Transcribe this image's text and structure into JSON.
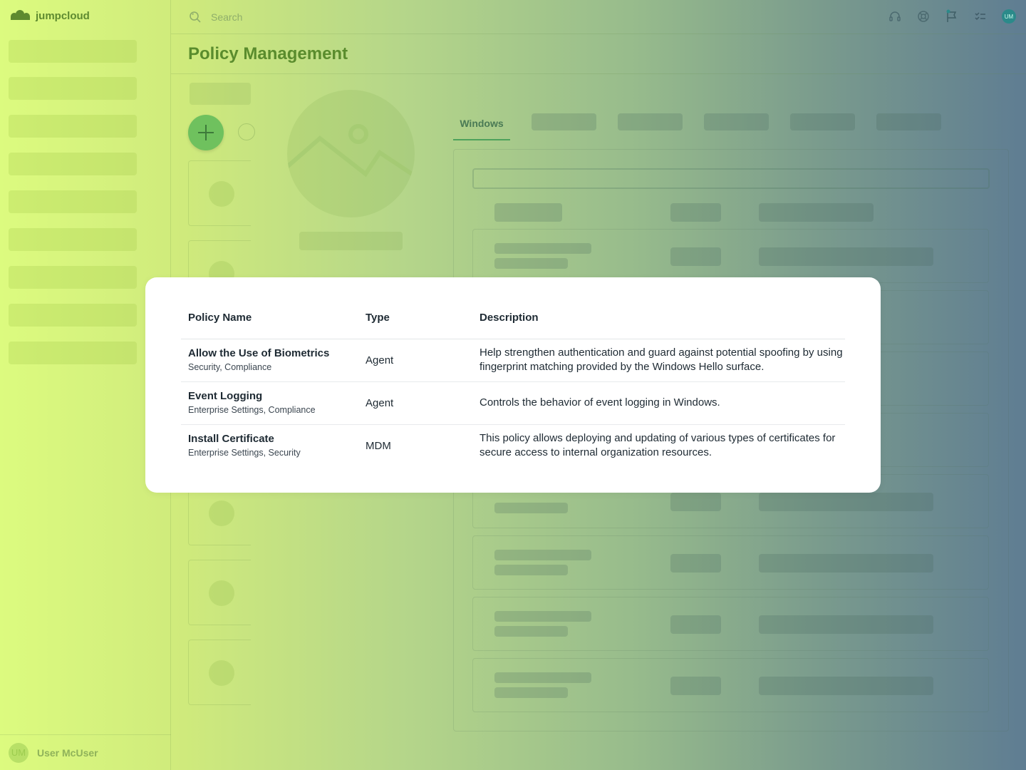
{
  "app": {
    "brand": "jumpcloud"
  },
  "search": {
    "placeholder": "Search"
  },
  "header": {
    "title": "Policy Management"
  },
  "top_icons": [
    "headset-icon",
    "help-icon",
    "flag-icon",
    "checklist-icon",
    "user-avatar"
  ],
  "user": {
    "initials": "UM",
    "name": "User McUser"
  },
  "tabs": {
    "active": "Windows"
  },
  "modal": {
    "columns": {
      "name": "Policy Name",
      "type": "Type",
      "description": "Description"
    },
    "rows": [
      {
        "name": "Allow the Use of Biometrics",
        "tags": "Security, Compliance",
        "type": "Agent",
        "description": "Help strengthen authentication and guard against potential spoofing by using fingerprint matching provided by the Windows Hello surface."
      },
      {
        "name": "Event Logging",
        "tags": "Enterprise Settings, Compliance",
        "type": "Agent",
        "description": "Controls the behavior of event logging in Windows."
      },
      {
        "name": "Install Certificate",
        "tags": "Enterprise Settings, Security",
        "type": "MDM",
        "description": "This policy allows deploying and updating of various types of certificates for secure access to internal organization resources."
      }
    ]
  },
  "colors": {
    "brand": "#5e8a2f",
    "accent": "#6fc15e",
    "tab_underline": "#4ea25c"
  }
}
